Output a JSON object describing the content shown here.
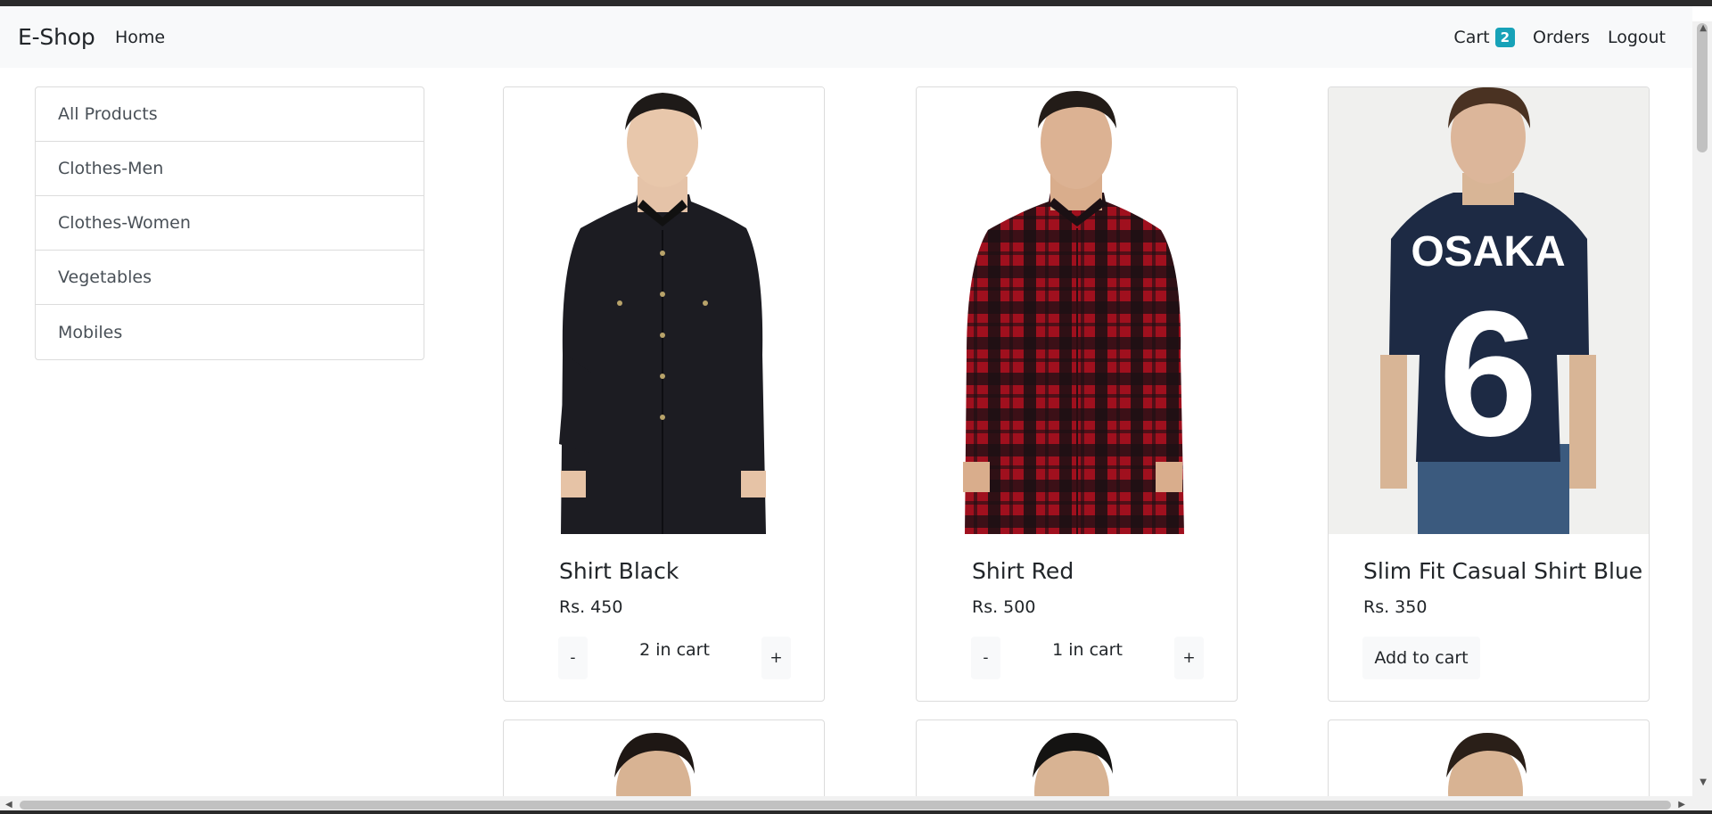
{
  "navbar": {
    "brand": "E-Shop",
    "home": "Home",
    "cart_label": "Cart",
    "cart_count": "2",
    "orders": "Orders",
    "logout": "Logout"
  },
  "sidebar": {
    "items": [
      {
        "label": "All Products"
      },
      {
        "label": "Clothes-Men"
      },
      {
        "label": "Clothes-Women"
      },
      {
        "label": "Vegetables"
      },
      {
        "label": "Mobiles"
      }
    ]
  },
  "products": [
    {
      "title": "Shirt Black",
      "price": "Rs. 450",
      "in_cart": "2 in cart",
      "minus": "-",
      "plus": "+"
    },
    {
      "title": "Shirt Red",
      "price": "Rs. 500",
      "in_cart": "1 in cart",
      "minus": "-",
      "plus": "+"
    },
    {
      "title": "Slim Fit Casual Shirt Blue",
      "price": "Rs. 350",
      "add_to_cart": "Add to cart",
      "tshirt_text": "OSAKA",
      "tshirt_number": "6"
    }
  ],
  "colors": {
    "accent_badge": "#17a2b8",
    "navbar_bg": "#f8f9fa",
    "border": "#dcdcdc"
  }
}
